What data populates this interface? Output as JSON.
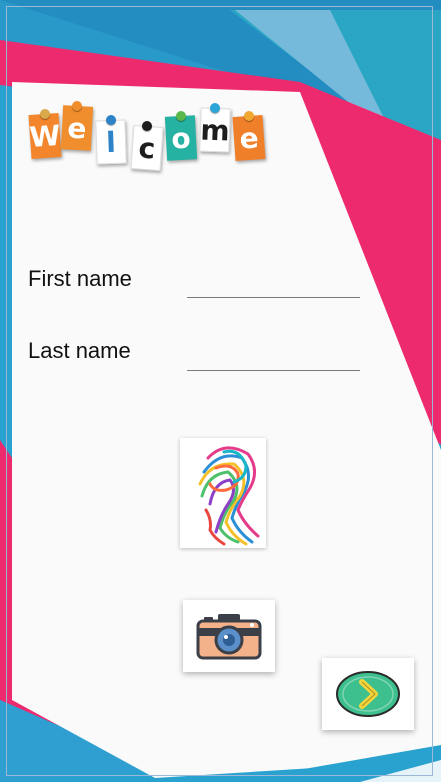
{
  "welcome": {
    "letters": [
      {
        "char": "W",
        "tile": "#f3852c",
        "pin": "#d9a94a"
      },
      {
        "char": "e",
        "tile": "#f08e2e",
        "pin": "#f08e2e"
      },
      {
        "char": "l",
        "tile": "#ffffff",
        "pin": "#2c83c8"
      },
      {
        "char": "c",
        "tile": "#ffffff",
        "pin": "#1d1d1d"
      },
      {
        "char": "o",
        "tile": "#25b2a2",
        "pin": "#5ab84a"
      },
      {
        "char": "m",
        "tile": "#ffffff",
        "pin": "#2ca6d6"
      },
      {
        "char": "e",
        "tile": "#f07f2a",
        "pin": "#f0a830"
      }
    ],
    "icon": "welcome-sign-icon"
  },
  "form": {
    "first_name_label": "First name",
    "first_name_value": "",
    "last_name_label": "Last name",
    "last_name_value": ""
  },
  "images": {
    "avatar_icon": "abstract-head-art",
    "camera_icon": "camera-icon",
    "next_icon": "chevron-right-icon"
  },
  "colors": {
    "primary_blue": "#2192c4",
    "accent_pink": "#ee2a6e",
    "teal": "#2ec1c3",
    "card": "#fafafa",
    "next_button": "#3dbf8e"
  }
}
